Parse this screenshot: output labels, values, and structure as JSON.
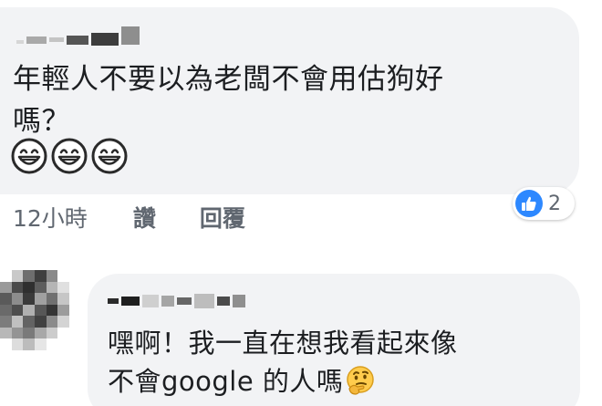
{
  "comment1": {
    "text": "年輕人不要以為老闆不會用估狗好\n嗎？",
    "emojis": [
      "grinning-face",
      "grinning-face",
      "grinning-face"
    ],
    "timestamp": "12小時",
    "like_label": "讚",
    "reply_label": "回覆",
    "reaction": {
      "icon": "thumbs-up-icon",
      "count": "2"
    }
  },
  "comment2": {
    "text": "嘿啊！我一直在想我看起來像\n不會google 的人嗎",
    "emoji": "thinking-face"
  },
  "colors": {
    "bubble": "#f2f3f5",
    "meta_text": "#606770",
    "like_blue": "#2d88ff"
  }
}
